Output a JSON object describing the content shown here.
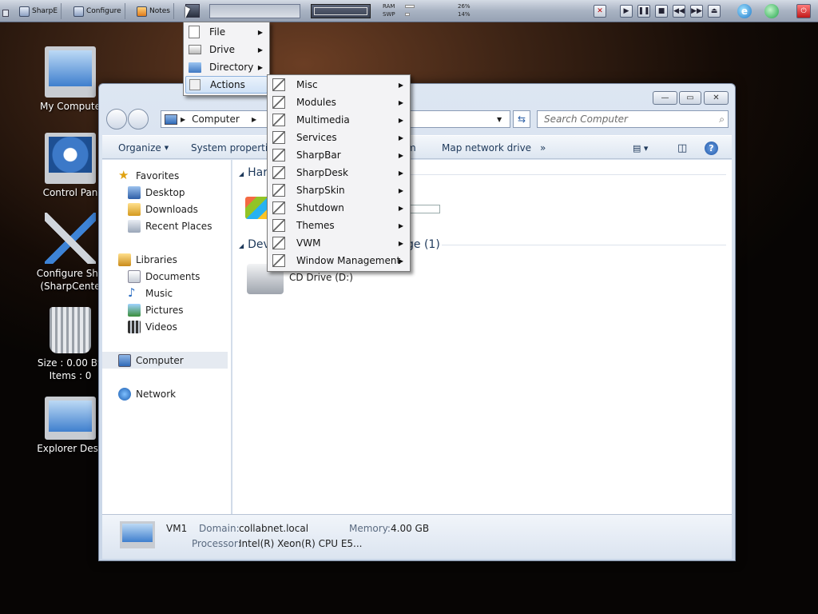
{
  "taskbar": {
    "buttons": [
      {
        "label": "SharpE"
      },
      {
        "label": "Configure"
      },
      {
        "label": "Notes"
      }
    ],
    "gauges": {
      "ram_label": "RAM",
      "swp_label": "SWP",
      "ram_value": "26%",
      "swp_value": "14%"
    }
  },
  "desktop": {
    "icons": [
      {
        "label": "My Compute"
      },
      {
        "label": "Control Pan"
      },
      {
        "label": "Configure Sha\n(SharpCente"
      },
      {
        "label": "Size : 0.00 By\nItems : 0"
      },
      {
        "label": "Explorer Desk"
      }
    ]
  },
  "window": {
    "address": "Computer",
    "search_placeholder": "Search Computer",
    "toolbar": {
      "organize": "Organize",
      "system_properties": "System properties",
      "uninstall_partial": "m",
      "map_drive": "Map network drive",
      "more": "»"
    },
    "nav": {
      "favorites": "Favorites",
      "desktop": "Desktop",
      "downloads": "Downloads",
      "recent": "Recent Places",
      "libraries": "Libraries",
      "documents": "Documents",
      "music": "Music",
      "pictures": "Pictures",
      "videos": "Videos",
      "computer": "Computer",
      "network": "Network"
    },
    "content": {
      "group1_partial": "Har",
      "group2_partial": "Dev",
      "group2_tail": "ge (1)",
      "cd_drive": "CD Drive (D:)"
    },
    "details": {
      "name": "VM1",
      "domain_label": "Domain:",
      "domain_value": "collabnet.local",
      "memory_label": "Memory:",
      "memory_value": "4.00 GB",
      "processor_label": "Processor:",
      "processor_value": "Intel(R) Xeon(R) CPU E5..."
    }
  },
  "menu1": {
    "items": [
      "File",
      "Drive",
      "Directory",
      "Actions"
    ]
  },
  "menu2": {
    "items": [
      "Misc",
      "Modules",
      "Multimedia",
      "Services",
      "SharpBar",
      "SharpDesk",
      "SharpSkin",
      "Shutdown",
      "Themes",
      "VWM",
      "Window Management"
    ]
  }
}
